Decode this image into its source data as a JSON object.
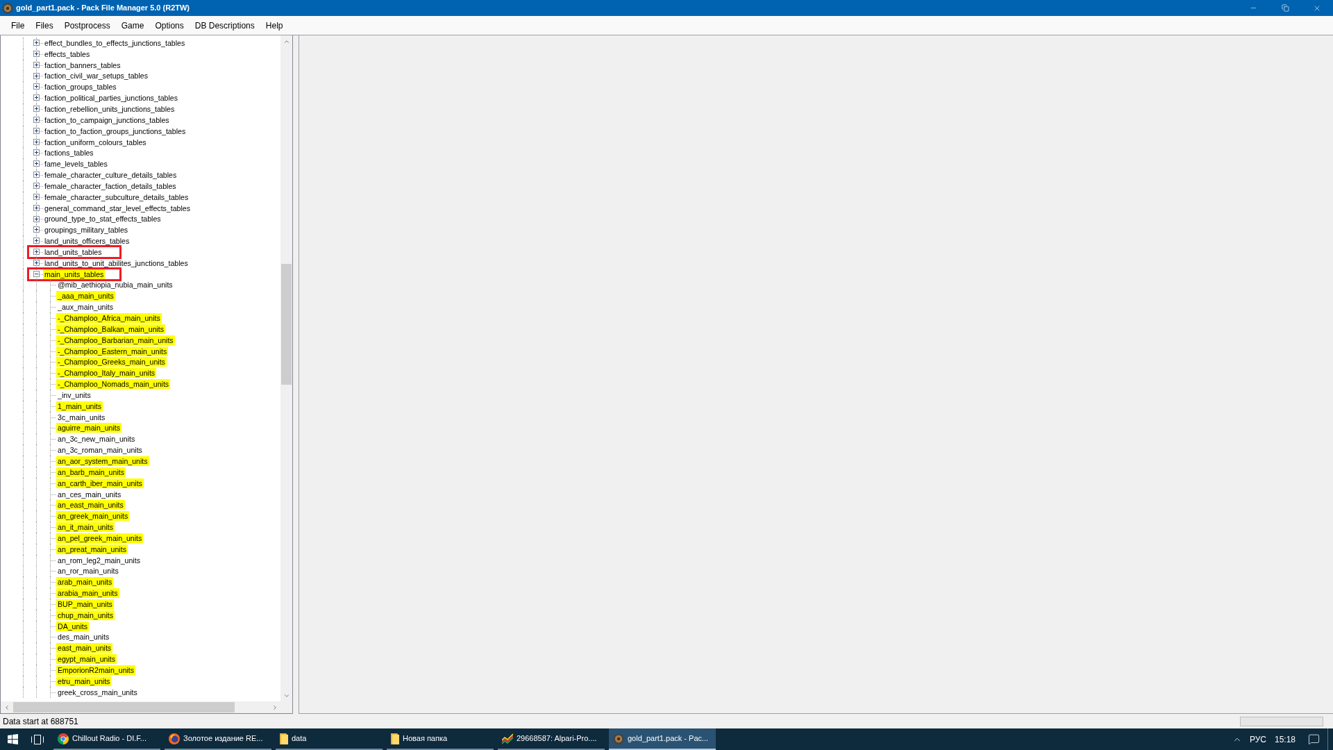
{
  "window": {
    "title": "gold_part1.pack - Pack File Manager 5.0 (R2TW)"
  },
  "menu": [
    "File",
    "Files",
    "Postprocess",
    "Game",
    "Options",
    "DB Descriptions",
    "Help"
  ],
  "tree": {
    "nodes": [
      {
        "label": "effect_bundles_to_effects_junctions_tables",
        "expanded": false,
        "highlighted": false,
        "outlined": false
      },
      {
        "label": "effects_tables",
        "expanded": false,
        "highlighted": false,
        "outlined": false
      },
      {
        "label": "faction_banners_tables",
        "expanded": false,
        "highlighted": false,
        "outlined": false
      },
      {
        "label": "faction_civil_war_setups_tables",
        "expanded": false,
        "highlighted": false,
        "outlined": false
      },
      {
        "label": "faction_groups_tables",
        "expanded": false,
        "highlighted": false,
        "outlined": false
      },
      {
        "label": "faction_political_parties_junctions_tables",
        "expanded": false,
        "highlighted": false,
        "outlined": false
      },
      {
        "label": "faction_rebellion_units_junctions_tables",
        "expanded": false,
        "highlighted": false,
        "outlined": false
      },
      {
        "label": "faction_to_campaign_junctions_tables",
        "expanded": false,
        "highlighted": false,
        "outlined": false
      },
      {
        "label": "faction_to_faction_groups_junctions_tables",
        "expanded": false,
        "highlighted": false,
        "outlined": false
      },
      {
        "label": "faction_uniform_colours_tables",
        "expanded": false,
        "highlighted": false,
        "outlined": false
      },
      {
        "label": "factions_tables",
        "expanded": false,
        "highlighted": false,
        "outlined": false
      },
      {
        "label": "fame_levels_tables",
        "expanded": false,
        "highlighted": false,
        "outlined": false
      },
      {
        "label": "female_character_culture_details_tables",
        "expanded": false,
        "highlighted": false,
        "outlined": false
      },
      {
        "label": "female_character_faction_details_tables",
        "expanded": false,
        "highlighted": false,
        "outlined": false
      },
      {
        "label": "female_character_subculture_details_tables",
        "expanded": false,
        "highlighted": false,
        "outlined": false
      },
      {
        "label": "general_command_star_level_effects_tables",
        "expanded": false,
        "highlighted": false,
        "outlined": false
      },
      {
        "label": "ground_type_to_stat_effects_tables",
        "expanded": false,
        "highlighted": false,
        "outlined": false
      },
      {
        "label": "groupings_military_tables",
        "expanded": false,
        "highlighted": false,
        "outlined": false
      },
      {
        "label": "land_units_officers_tables",
        "expanded": false,
        "highlighted": false,
        "outlined": false
      },
      {
        "label": "land_units_tables",
        "expanded": false,
        "highlighted": false,
        "outlined": true
      },
      {
        "label": "land_units_to_unit_abilites_junctions_tables",
        "expanded": false,
        "highlighted": false,
        "outlined": false
      },
      {
        "label": "main_units_tables",
        "expanded": true,
        "highlighted": true,
        "outlined": true,
        "children": [
          {
            "label": "@mib_aethiopia_nubia_main_units",
            "highlighted": false
          },
          {
            "label": "_aaa_main_units",
            "highlighted": true
          },
          {
            "label": "_aux_main_units",
            "highlighted": false
          },
          {
            "label": "-_Champloo_Africa_main_units",
            "highlighted": true
          },
          {
            "label": "-_Champloo_Balkan_main_units",
            "highlighted": true
          },
          {
            "label": "-_Champloo_Barbarian_main_units",
            "highlighted": true
          },
          {
            "label": "-_Champloo_Eastern_main_units",
            "highlighted": true
          },
          {
            "label": "-_Champloo_Greeks_main_units",
            "highlighted": true
          },
          {
            "label": "-_Champloo_Italy_main_units",
            "highlighted": true
          },
          {
            "label": "-_Champloo_Nomads_main_units",
            "highlighted": true
          },
          {
            "label": "_inv_units",
            "highlighted": false
          },
          {
            "label": "1_main_units",
            "highlighted": true
          },
          {
            "label": "3c_main_units",
            "highlighted": false
          },
          {
            "label": "aguirre_main_units",
            "highlighted": true
          },
          {
            "label": "an_3c_new_main_units",
            "highlighted": false
          },
          {
            "label": "an_3c_roman_main_units",
            "highlighted": false
          },
          {
            "label": "an_aor_system_main_units",
            "highlighted": true
          },
          {
            "label": "an_barb_main_units",
            "highlighted": true
          },
          {
            "label": "an_carth_iber_main_units",
            "highlighted": true
          },
          {
            "label": "an_ces_main_units",
            "highlighted": false
          },
          {
            "label": "an_east_main_units",
            "highlighted": true
          },
          {
            "label": "an_greek_main_units",
            "highlighted": true
          },
          {
            "label": "an_it_main_units",
            "highlighted": true
          },
          {
            "label": "an_pel_greek_main_units",
            "highlighted": true
          },
          {
            "label": "an_preat_main_units",
            "highlighted": true
          },
          {
            "label": "an_rom_leg2_main_units",
            "highlighted": false
          },
          {
            "label": "an_ror_main_units",
            "highlighted": false
          },
          {
            "label": "arab_main_units",
            "highlighted": true
          },
          {
            "label": "arabia_main_units",
            "highlighted": true
          },
          {
            "label": "BUP_main_units",
            "highlighted": true
          },
          {
            "label": "chup_main_units",
            "highlighted": true
          },
          {
            "label": "DA_units",
            "highlighted": true
          },
          {
            "label": "des_main_units",
            "highlighted": false
          },
          {
            "label": "east_main_units",
            "highlighted": true
          },
          {
            "label": "egypt_main_units",
            "highlighted": true
          },
          {
            "label": "EmporionR2main_units",
            "highlighted": true
          },
          {
            "label": "etru_main_units",
            "highlighted": true
          },
          {
            "label": "greek_cross_main_units",
            "highlighted": false
          }
        ]
      }
    ]
  },
  "status_bar": {
    "text": "Data start at 688751",
    "progress": {
      "level": 0
    }
  },
  "taskbar": {
    "apps": [
      {
        "kind": "disc",
        "label": "Chillout Radio - DI.F...",
        "selected": false
      },
      {
        "kind": "orb",
        "label": "Золотое издание RE...",
        "selected": false
      },
      {
        "kind": "folder",
        "label": "data",
        "selected": false
      },
      {
        "kind": "folder",
        "label": "Новая папка",
        "selected": false
      },
      {
        "kind": "chart",
        "label": "29668587: Alpari-Pro....",
        "selected": false
      },
      {
        "kind": "gear",
        "label": "gold_part1.pack - Pac...",
        "selected": true
      }
    ],
    "tray": {
      "language": "РУС",
      "time": "15:18"
    }
  }
}
